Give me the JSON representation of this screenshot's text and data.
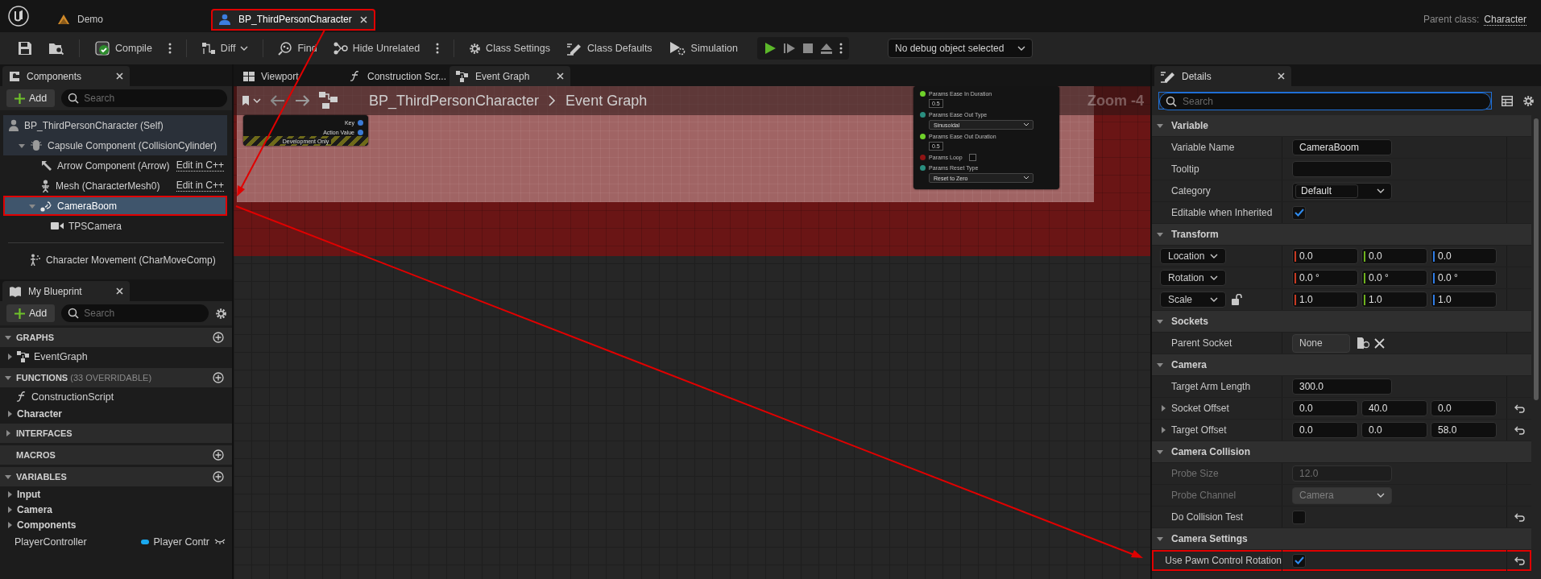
{
  "title_bar": {
    "tabs": [
      {
        "label": "Demo",
        "kind": "project",
        "selected": false,
        "highlighted": false
      },
      {
        "label": "BP_ThirdPersonCharacter",
        "kind": "blueprint",
        "selected": true,
        "highlighted": true
      }
    ],
    "parent_class_label": "Parent class:",
    "parent_class": "Character"
  },
  "toolbar": {
    "items": [
      {
        "kind": "save"
      },
      {
        "kind": "browse"
      },
      {
        "kind": "divider"
      },
      {
        "kind": "compile",
        "label": "Compile"
      },
      {
        "kind": "more"
      },
      {
        "kind": "divider"
      },
      {
        "kind": "diff",
        "label": "Diff"
      },
      {
        "kind": "divider"
      },
      {
        "kind": "find",
        "label": "Find"
      },
      {
        "kind": "hide",
        "label": "Hide Unrelated"
      },
      {
        "kind": "more"
      },
      {
        "kind": "divider"
      },
      {
        "kind": "settings",
        "label": "Class Settings"
      },
      {
        "kind": "defaults",
        "label": "Class Defaults"
      },
      {
        "kind": "simulation",
        "label": "Simulation"
      }
    ],
    "debug_object": "No debug object selected"
  },
  "components": {
    "title": "Components",
    "add": "Add",
    "search_placeholder": "Search",
    "tree": [
      {
        "label": "BP_ThirdPersonCharacter (Self)",
        "kind": "self",
        "shaded": true,
        "selected": false,
        "highlighted": false,
        "children": [
          {
            "label": "Capsule Component (CollisionCylinder)",
            "kind": "capsule",
            "shaded": true,
            "selected": false,
            "highlighted": false,
            "expanded": true,
            "children": [
              {
                "label": "Arrow Component (Arrow)",
                "kind": "arrow",
                "shaded": false,
                "selected": false,
                "highlighted": false,
                "link": "Edit in C++"
              },
              {
                "label": "Mesh (CharacterMesh0)",
                "kind": "mesh",
                "shaded": false,
                "selected": false,
                "highlighted": false,
                "link": "Edit in C++"
              },
              {
                "label": "CameraBoom",
                "kind": "spring_arm",
                "shaded": false,
                "selected": true,
                "highlighted": true,
                "expanded": true,
                "children": [
                  {
                    "label": "TPSCamera",
                    "kind": "camera",
                    "shaded": false,
                    "selected": false,
                    "highlighted": false
                  }
                ]
              }
            ]
          }
        ]
      }
    ],
    "extra": [
      {
        "label": "Character Movement (CharMoveComp)",
        "kind": "movement",
        "shaded": false,
        "selected": false,
        "highlighted": false
      }
    ]
  },
  "my_blueprint": {
    "title": "My Blueprint",
    "add": "Add",
    "search_placeholder": "Search",
    "sections": [
      {
        "title": "GRAPHS",
        "expanded": true,
        "addable": true,
        "items": [
          {
            "label": "EventGraph",
            "kind": "graph"
          }
        ]
      },
      {
        "title": "FUNCTIONS",
        "note": "(33 OVERRIDABLE)",
        "expanded": true,
        "addable": true,
        "items": [
          {
            "label": "ConstructionScript",
            "kind": "function"
          },
          {
            "label": "Character",
            "kind": "category"
          }
        ]
      },
      {
        "title": "INTERFACES",
        "expanded": false,
        "addable": false
      },
      {
        "title": "MACROS",
        "addable": true
      },
      {
        "title": "VARIABLES",
        "expanded": true,
        "addable": true,
        "items": [
          {
            "label": "Input",
            "kind": "category"
          },
          {
            "label": "Camera",
            "kind": "category"
          },
          {
            "label": "Components",
            "kind": "category"
          },
          {
            "label": "PlayerController",
            "kind": "variable",
            "type": "Player Contr",
            "color": "#1aa9f0"
          }
        ]
      }
    ]
  },
  "graph_editor": {
    "tabs": [
      {
        "label": "Viewport",
        "kind": "viewport",
        "selected": false
      },
      {
        "label": "Construction Scr...",
        "kind": "function",
        "selected": false
      },
      {
        "label": "Event Graph",
        "kind": "graph",
        "selected": true
      }
    ],
    "breadcrumb": [
      "BP_ThirdPersonCharacter",
      "Event Graph"
    ],
    "zoom": "Zoom -4",
    "nodes": [
      {
        "kind": "input_action",
        "pins": [
          {
            "label": "Key",
            "color": "#3b7bd6"
          },
          {
            "label": "Action Value",
            "color": "#3b7bd6"
          }
        ],
        "footer": "Development Only"
      },
      {
        "kind": "params",
        "pins": [
          {
            "label": "Params Ease In Duration",
            "kind": "number",
            "value": "0.5",
            "color": "#6fd12a"
          },
          {
            "label": "Params Ease Out Type",
            "kind": "enum",
            "value": "Sinusoidal",
            "color": "#2a8f80"
          },
          {
            "label": "Params Ease Out Duration",
            "kind": "number",
            "value": "0.5",
            "color": "#6fd12a"
          },
          {
            "label": "Params Loop",
            "kind": "bool",
            "checked": false,
            "color": "#8f1414"
          },
          {
            "label": "Params Reset Type",
            "kind": "enum",
            "value": "Reset to Zero",
            "color": "#2a8f80"
          }
        ]
      }
    ]
  },
  "details": {
    "title": "Details",
    "search_placeholder": "Search",
    "sections": [
      {
        "title": "Variable",
        "expanded": true,
        "rows": [
          {
            "kind": "text",
            "label": "Variable Name",
            "value": "CameraBoom",
            "disabled": false,
            "highlighted": false
          },
          {
            "kind": "text",
            "label": "Tooltip",
            "disabled": false,
            "highlighted": false
          },
          {
            "kind": "combo",
            "label": "Category",
            "value": "Default",
            "disabled": false,
            "highlighted": false
          },
          {
            "kind": "check",
            "label": "Editable when Inherited",
            "checked": true,
            "disabled": false,
            "highlighted": false
          }
        ]
      },
      {
        "title": "Transform",
        "expanded": true,
        "rows": [
          {
            "kind": "vector",
            "label": "Location",
            "label_menu": true,
            "axis_colors": true,
            "values": [
              "0.0",
              "0.0",
              "0.0"
            ],
            "disabled": false,
            "highlighted": false
          },
          {
            "kind": "vector",
            "label": "Rotation",
            "label_menu": true,
            "axis_colors": true,
            "values": [
              "0.0 °",
              "0.0 °",
              "0.0 °"
            ],
            "disabled": false,
            "highlighted": false
          },
          {
            "kind": "vector",
            "label": "Scale",
            "label_menu": true,
            "axis_colors": true,
            "locked": false,
            "values": [
              "1.0",
              "1.0",
              "1.0"
            ],
            "disabled": false,
            "highlighted": false
          }
        ]
      },
      {
        "title": "Sockets",
        "expanded": true,
        "rows": [
          {
            "kind": "socket",
            "label": "Parent Socket",
            "value": "None",
            "disabled": false,
            "highlighted": false
          }
        ]
      },
      {
        "title": "Camera",
        "expanded": true,
        "rows": [
          {
            "kind": "text",
            "label": "Target Arm Length",
            "value": "300.0",
            "disabled": false,
            "highlighted": false
          },
          {
            "kind": "vector",
            "label": "Socket Offset",
            "expanded": false,
            "label_menu": false,
            "axis_colors": false,
            "values": [
              "0.0",
              "40.0",
              "0.0"
            ],
            "reset": true,
            "disabled": false,
            "highlighted": false
          },
          {
            "kind": "vector",
            "label": "Target Offset",
            "expanded": false,
            "label_menu": false,
            "axis_colors": false,
            "values": [
              "0.0",
              "0.0",
              "58.0"
            ],
            "reset": true,
            "disabled": false,
            "highlighted": false
          }
        ]
      },
      {
        "title": "Camera Collision",
        "expanded": true,
        "rows": [
          {
            "kind": "text",
            "label": "Probe Size",
            "value": "12.0",
            "disabled": true,
            "highlighted": false
          },
          {
            "kind": "combo",
            "label": "Probe Channel",
            "value": "Camera",
            "disabled": true,
            "highlighted": false
          },
          {
            "kind": "check",
            "label": "Do Collision Test",
            "checked": false,
            "reset": true,
            "disabled": false,
            "highlighted": false
          }
        ]
      },
      {
        "title": "Camera Settings",
        "expanded": true,
        "rows": [
          {
            "kind": "check",
            "label": "Use Pawn Control Rotation",
            "checked": true,
            "reset": true,
            "disabled": false,
            "highlighted": true
          }
        ]
      }
    ]
  }
}
